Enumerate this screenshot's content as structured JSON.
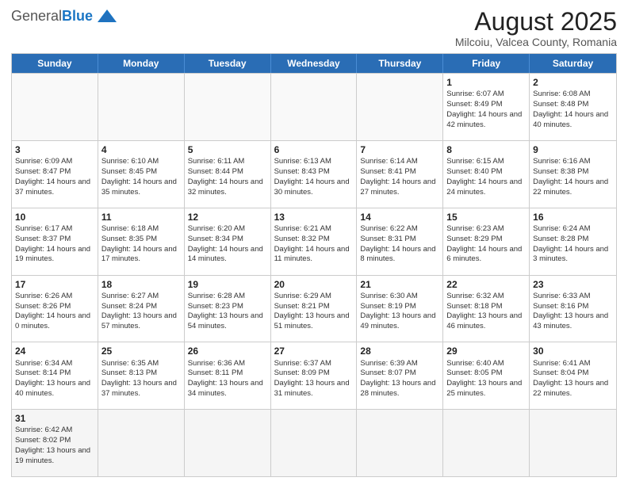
{
  "header": {
    "logo_general": "General",
    "logo_blue": "Blue",
    "title": "August 2025",
    "subtitle": "Milcoiu, Valcea County, Romania"
  },
  "weekdays": [
    "Sunday",
    "Monday",
    "Tuesday",
    "Wednesday",
    "Thursday",
    "Friday",
    "Saturday"
  ],
  "rows": [
    [
      {
        "day": "",
        "info": ""
      },
      {
        "day": "",
        "info": ""
      },
      {
        "day": "",
        "info": ""
      },
      {
        "day": "",
        "info": ""
      },
      {
        "day": "",
        "info": ""
      },
      {
        "day": "1",
        "info": "Sunrise: 6:07 AM\nSunset: 8:49 PM\nDaylight: 14 hours and 42 minutes."
      },
      {
        "day": "2",
        "info": "Sunrise: 6:08 AM\nSunset: 8:48 PM\nDaylight: 14 hours and 40 minutes."
      }
    ],
    [
      {
        "day": "3",
        "info": "Sunrise: 6:09 AM\nSunset: 8:47 PM\nDaylight: 14 hours and 37 minutes."
      },
      {
        "day": "4",
        "info": "Sunrise: 6:10 AM\nSunset: 8:45 PM\nDaylight: 14 hours and 35 minutes."
      },
      {
        "day": "5",
        "info": "Sunrise: 6:11 AM\nSunset: 8:44 PM\nDaylight: 14 hours and 32 minutes."
      },
      {
        "day": "6",
        "info": "Sunrise: 6:13 AM\nSunset: 8:43 PM\nDaylight: 14 hours and 30 minutes."
      },
      {
        "day": "7",
        "info": "Sunrise: 6:14 AM\nSunset: 8:41 PM\nDaylight: 14 hours and 27 minutes."
      },
      {
        "day": "8",
        "info": "Sunrise: 6:15 AM\nSunset: 8:40 PM\nDaylight: 14 hours and 24 minutes."
      },
      {
        "day": "9",
        "info": "Sunrise: 6:16 AM\nSunset: 8:38 PM\nDaylight: 14 hours and 22 minutes."
      }
    ],
    [
      {
        "day": "10",
        "info": "Sunrise: 6:17 AM\nSunset: 8:37 PM\nDaylight: 14 hours and 19 minutes."
      },
      {
        "day": "11",
        "info": "Sunrise: 6:18 AM\nSunset: 8:35 PM\nDaylight: 14 hours and 17 minutes."
      },
      {
        "day": "12",
        "info": "Sunrise: 6:20 AM\nSunset: 8:34 PM\nDaylight: 14 hours and 14 minutes."
      },
      {
        "day": "13",
        "info": "Sunrise: 6:21 AM\nSunset: 8:32 PM\nDaylight: 14 hours and 11 minutes."
      },
      {
        "day": "14",
        "info": "Sunrise: 6:22 AM\nSunset: 8:31 PM\nDaylight: 14 hours and 8 minutes."
      },
      {
        "day": "15",
        "info": "Sunrise: 6:23 AM\nSunset: 8:29 PM\nDaylight: 14 hours and 6 minutes."
      },
      {
        "day": "16",
        "info": "Sunrise: 6:24 AM\nSunset: 8:28 PM\nDaylight: 14 hours and 3 minutes."
      }
    ],
    [
      {
        "day": "17",
        "info": "Sunrise: 6:26 AM\nSunset: 8:26 PM\nDaylight: 14 hours and 0 minutes."
      },
      {
        "day": "18",
        "info": "Sunrise: 6:27 AM\nSunset: 8:24 PM\nDaylight: 13 hours and 57 minutes."
      },
      {
        "day": "19",
        "info": "Sunrise: 6:28 AM\nSunset: 8:23 PM\nDaylight: 13 hours and 54 minutes."
      },
      {
        "day": "20",
        "info": "Sunrise: 6:29 AM\nSunset: 8:21 PM\nDaylight: 13 hours and 51 minutes."
      },
      {
        "day": "21",
        "info": "Sunrise: 6:30 AM\nSunset: 8:19 PM\nDaylight: 13 hours and 49 minutes."
      },
      {
        "day": "22",
        "info": "Sunrise: 6:32 AM\nSunset: 8:18 PM\nDaylight: 13 hours and 46 minutes."
      },
      {
        "day": "23",
        "info": "Sunrise: 6:33 AM\nSunset: 8:16 PM\nDaylight: 13 hours and 43 minutes."
      }
    ],
    [
      {
        "day": "24",
        "info": "Sunrise: 6:34 AM\nSunset: 8:14 PM\nDaylight: 13 hours and 40 minutes."
      },
      {
        "day": "25",
        "info": "Sunrise: 6:35 AM\nSunset: 8:13 PM\nDaylight: 13 hours and 37 minutes."
      },
      {
        "day": "26",
        "info": "Sunrise: 6:36 AM\nSunset: 8:11 PM\nDaylight: 13 hours and 34 minutes."
      },
      {
        "day": "27",
        "info": "Sunrise: 6:37 AM\nSunset: 8:09 PM\nDaylight: 13 hours and 31 minutes."
      },
      {
        "day": "28",
        "info": "Sunrise: 6:39 AM\nSunset: 8:07 PM\nDaylight: 13 hours and 28 minutes."
      },
      {
        "day": "29",
        "info": "Sunrise: 6:40 AM\nSunset: 8:05 PM\nDaylight: 13 hours and 25 minutes."
      },
      {
        "day": "30",
        "info": "Sunrise: 6:41 AM\nSunset: 8:04 PM\nDaylight: 13 hours and 22 minutes."
      }
    ],
    [
      {
        "day": "31",
        "info": "Sunrise: 6:42 AM\nSunset: 8:02 PM\nDaylight: 13 hours and 19 minutes."
      },
      {
        "day": "",
        "info": ""
      },
      {
        "day": "",
        "info": ""
      },
      {
        "day": "",
        "info": ""
      },
      {
        "day": "",
        "info": ""
      },
      {
        "day": "",
        "info": ""
      },
      {
        "day": "",
        "info": ""
      }
    ]
  ]
}
